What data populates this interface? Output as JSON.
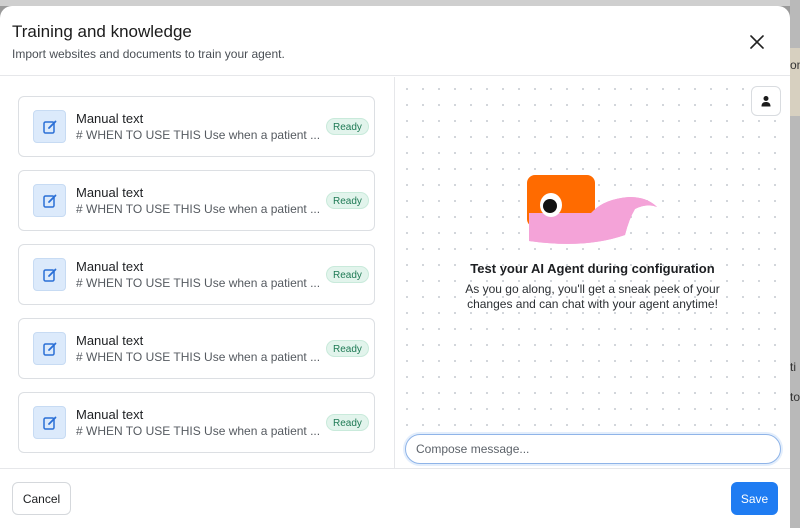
{
  "modal": {
    "title": "Training and knowledge",
    "subtitle": "Import websites and documents to train your agent.",
    "close_icon": "close-icon"
  },
  "sources": [
    {
      "title": "Manual text",
      "description": "# WHEN TO USE THIS Use when a patient ...",
      "status": "Ready",
      "icon": "edit-icon"
    },
    {
      "title": "Manual text",
      "description": "# WHEN TO USE THIS Use when a patient ...",
      "status": "Ready",
      "icon": "edit-icon"
    },
    {
      "title": "Manual text",
      "description": "# WHEN TO USE THIS Use when a patient ...",
      "status": "Ready",
      "icon": "edit-icon"
    },
    {
      "title": "Manual text",
      "description": "# WHEN TO USE THIS Use when a patient ...",
      "status": "Ready",
      "icon": "edit-icon"
    },
    {
      "title": "Manual text",
      "description": "# WHEN TO USE THIS Use when a patient ...",
      "status": "Ready",
      "icon": "edit-icon"
    }
  ],
  "preview": {
    "title": "Test your AI Agent during configuration",
    "text": "As you go along, you'll get a sneak peek of your changes and can chat with your agent anytime!",
    "compose_placeholder": "Compose message...",
    "avatar_icon": "person-icon"
  },
  "footer": {
    "cancel_label": "Cancel",
    "save_label": "Save"
  },
  "background": {
    "fragments": [
      "on",
      "ti",
      "to"
    ]
  },
  "colors": {
    "accent": "#1f7cf2",
    "badge_bg": "#e2f4ec",
    "badge_text": "#1f7a55",
    "mascot_orange": "#ff6b00",
    "mascot_pink": "#f4a3d8"
  }
}
